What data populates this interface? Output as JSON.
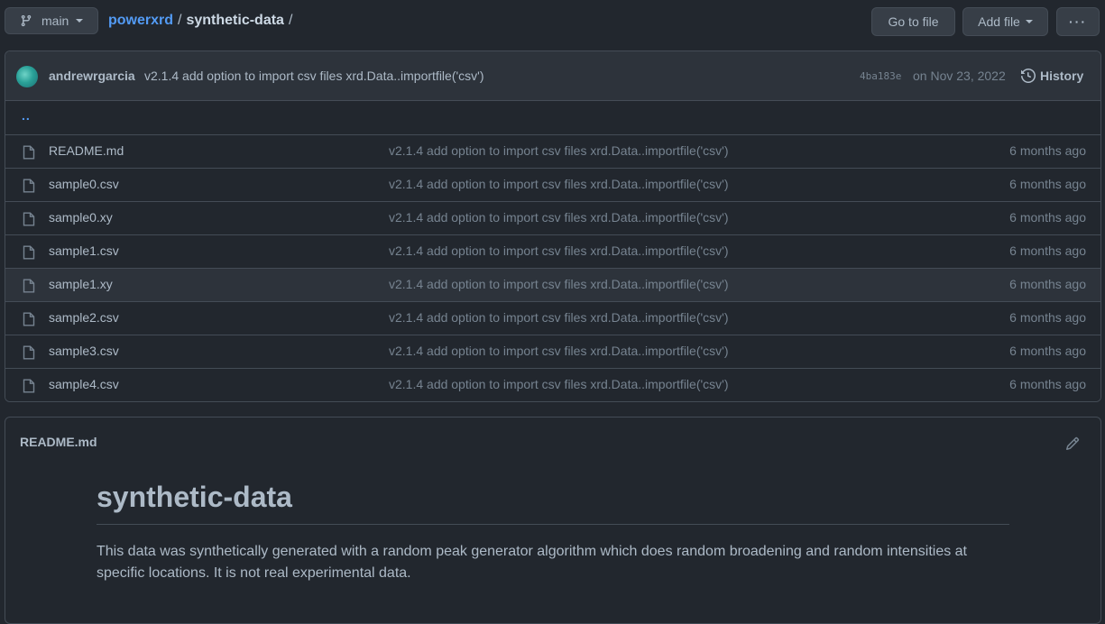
{
  "topbar": {
    "branch": "main",
    "repo": "powerxrd",
    "sep1": "/",
    "dir": "synthetic-data",
    "sep2": "/",
    "goto_label": "Go to file",
    "add_label": "Add file",
    "more_label": "···"
  },
  "commit": {
    "author": "andrewrgarcia",
    "message": "v2.1.4 add option to import csv files xrd.Data..importfile('csv')",
    "sha": "4ba183e",
    "date": "on Nov 23, 2022",
    "history_label": "History"
  },
  "updir": "..",
  "files": [
    {
      "name": "README.md",
      "message": "v2.1.4 add option to import csv files xrd.Data..importfile('csv')",
      "age": "6 months ago"
    },
    {
      "name": "sample0.csv",
      "message": "v2.1.4 add option to import csv files xrd.Data..importfile('csv')",
      "age": "6 months ago"
    },
    {
      "name": "sample0.xy",
      "message": "v2.1.4 add option to import csv files xrd.Data..importfile('csv')",
      "age": "6 months ago"
    },
    {
      "name": "sample1.csv",
      "message": "v2.1.4 add option to import csv files xrd.Data..importfile('csv')",
      "age": "6 months ago"
    },
    {
      "name": "sample1.xy",
      "message": "v2.1.4 add option to import csv files xrd.Data..importfile('csv')",
      "age": "6 months ago"
    },
    {
      "name": "sample2.csv",
      "message": "v2.1.4 add option to import csv files xrd.Data..importfile('csv')",
      "age": "6 months ago"
    },
    {
      "name": "sample3.csv",
      "message": "v2.1.4 add option to import csv files xrd.Data..importfile('csv')",
      "age": "6 months ago"
    },
    {
      "name": "sample4.csv",
      "message": "v2.1.4 add option to import csv files xrd.Data..importfile('csv')",
      "age": "6 months ago"
    }
  ],
  "readme": {
    "filename": "README.md",
    "heading": "synthetic-data",
    "body": "This data was synthetically generated with a random peak generator algorithm which does random broadening and random intensities at specific locations. It is not real experimental data."
  },
  "colors": {
    "background": "#22272e",
    "link": "#539bf5",
    "muted": "#768390",
    "border": "#444c56"
  }
}
